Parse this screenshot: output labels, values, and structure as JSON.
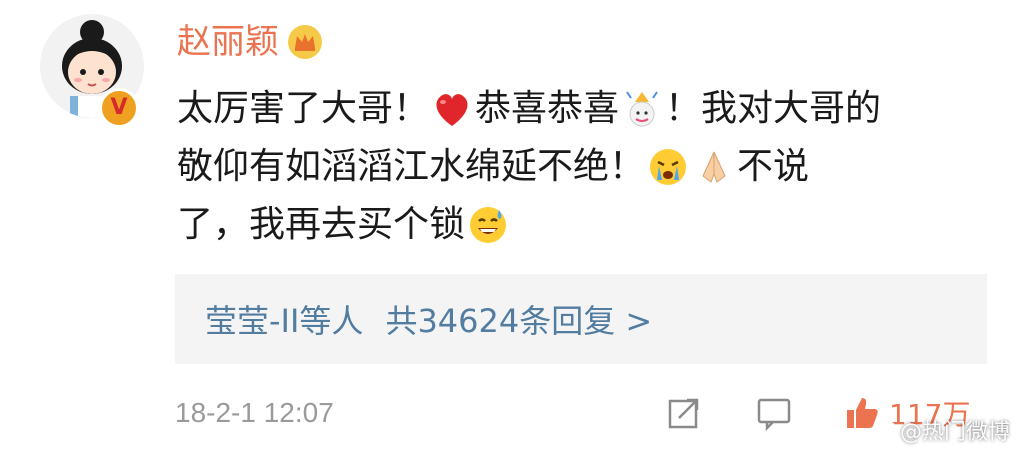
{
  "comment": {
    "username": "赵丽颖",
    "crown_icon": "crown-icon",
    "verified_badge": "V",
    "line1_a": "太厉害了大哥！",
    "line1_b": "恭喜恭喜",
    "line1_c": "！我对大哥的",
    "line2_a": "敬仰有如滔滔江水绵延不绝！",
    "line2_b": "不说",
    "line3_a": "了，我再去买个锁",
    "emojis": [
      "heart-icon",
      "party-icon",
      "crying-icon",
      "praying-hands-icon",
      "sweat-smile-icon"
    ]
  },
  "replies": {
    "users": "莹莹-II等人",
    "count_text": "共34624条回复 >"
  },
  "footer": {
    "timestamp": "18-2-1 12:07",
    "like_count": "117万"
  },
  "watermark": {
    "text": "@热门微博"
  },
  "colors": {
    "username": "#eb7350",
    "link": "#527ca0",
    "reply_bg": "#f4f4f4",
    "meta": "#9a9a9a"
  }
}
